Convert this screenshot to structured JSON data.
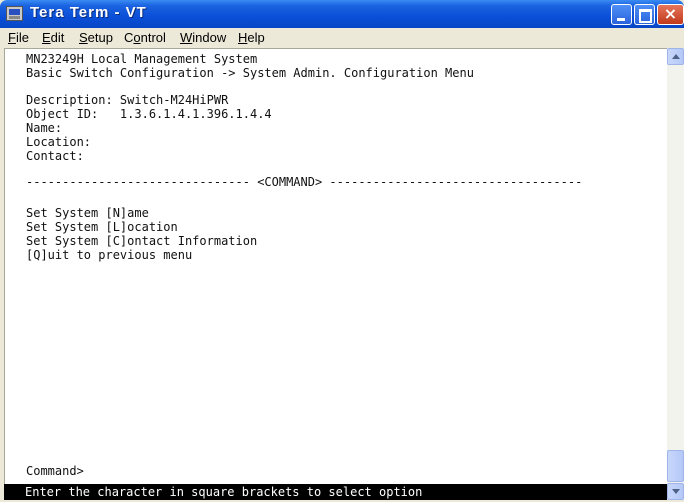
{
  "window": {
    "title": "Tera Term - VT",
    "icon": "terminal-app-icon",
    "controls": {
      "minimize": "minimize-icon",
      "maximize": "maximize-icon",
      "close": "×"
    }
  },
  "menu": {
    "items": [
      {
        "label": "File"
      },
      {
        "label": "Edit"
      },
      {
        "label": "Setup"
      },
      {
        "label": "Control"
      },
      {
        "label": "Window"
      },
      {
        "label": "Help"
      }
    ]
  },
  "terminal": {
    "header_line1": "MN23249H Local Management System",
    "header_line2": "Basic Switch Configuration -> System Admin. Configuration Menu",
    "description": "Description: Switch-M24HiPWR",
    "object_id": "Object ID:   1.3.6.1.4.1.396.1.4.4",
    "name": "Name:",
    "location": "Location:",
    "contact": "Contact:",
    "separator": "------------------------------- <COMMAND> -----------------------------------",
    "options": [
      "Set System [N]ame",
      "Set System [L]ocation",
      "Set System [C]ontact Information",
      "[Q]uit to previous menu"
    ],
    "prompt": "Command>",
    "status": "Enter the character in square brackets to select option"
  },
  "colors": {
    "titlebar": "#0a4fd8",
    "terminal_bg": "#ffffff",
    "status_bg": "#000000",
    "status_fg": "#ffffff"
  }
}
